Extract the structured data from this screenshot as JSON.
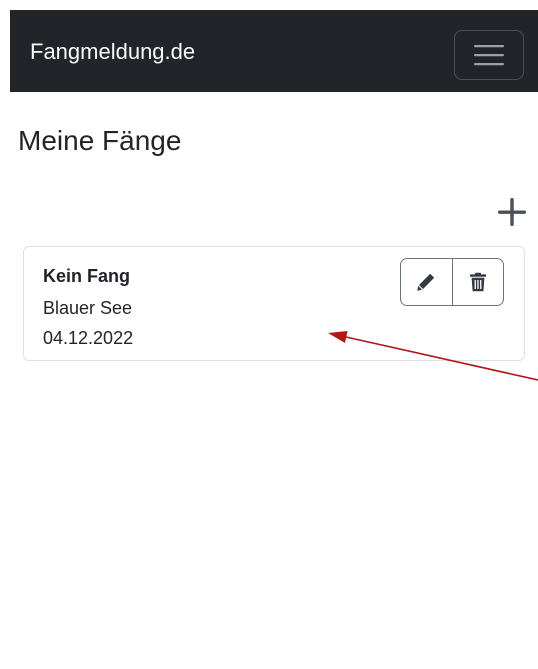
{
  "navbar": {
    "brand": "Fangmeldung.de",
    "menu_icon": "hamburger-menu-icon",
    "background": "#212529"
  },
  "page": {
    "title": "Meine Fänge",
    "add_icon": "plus-icon"
  },
  "catches": [
    {
      "title": "Kein Fang",
      "lake": "Blauer See",
      "date": "04.12.2022",
      "edit_icon": "pencil-icon",
      "delete_icon": "trash-icon"
    }
  ],
  "annotation": {
    "arrow_color": "#b01818"
  }
}
